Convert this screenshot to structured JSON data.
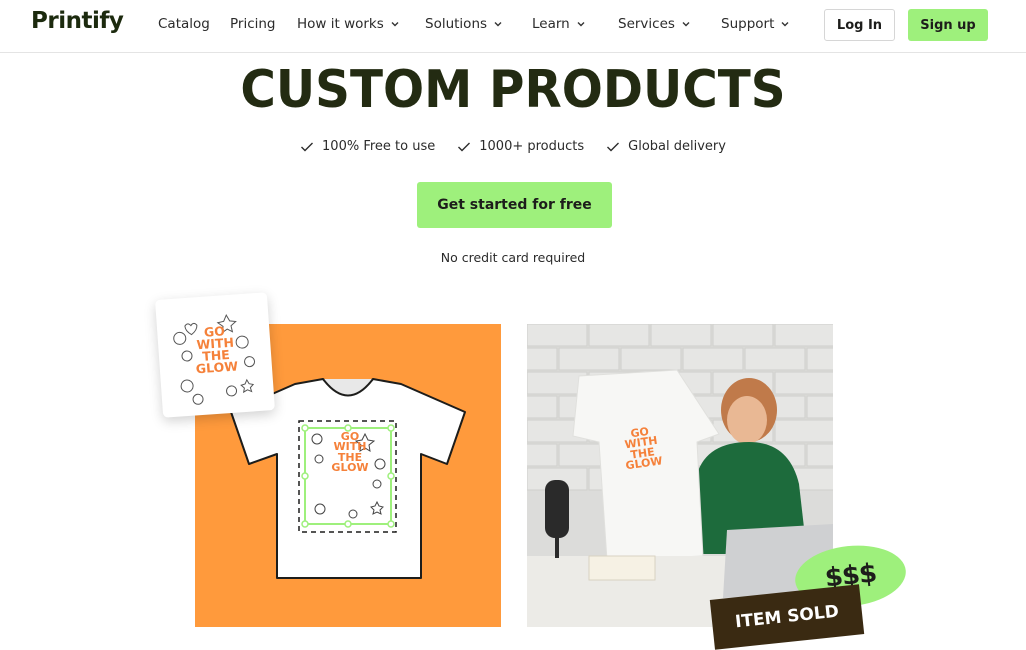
{
  "nav": {
    "logo": "Printify",
    "items": [
      "Catalog",
      "Pricing",
      "How it works",
      "Solutions",
      "Learn",
      "Services",
      "Support"
    ],
    "login": "Log In",
    "signup": "Sign up"
  },
  "hero": {
    "title": "CUSTOM PRODUCTS",
    "features": [
      "100% Free to use",
      "1000+ products",
      "Global delivery"
    ],
    "cta": "Get started for free",
    "note": "No credit card required"
  },
  "design": {
    "lines": [
      "GO",
      "WITH",
      "THE",
      "GLOW"
    ]
  },
  "badges": {
    "money": "$$$",
    "item_sold": "ITEM SOLD"
  },
  "colors": {
    "accent": "#9ef07c",
    "orange": "#ff9a3c",
    "dark": "#232b12"
  }
}
